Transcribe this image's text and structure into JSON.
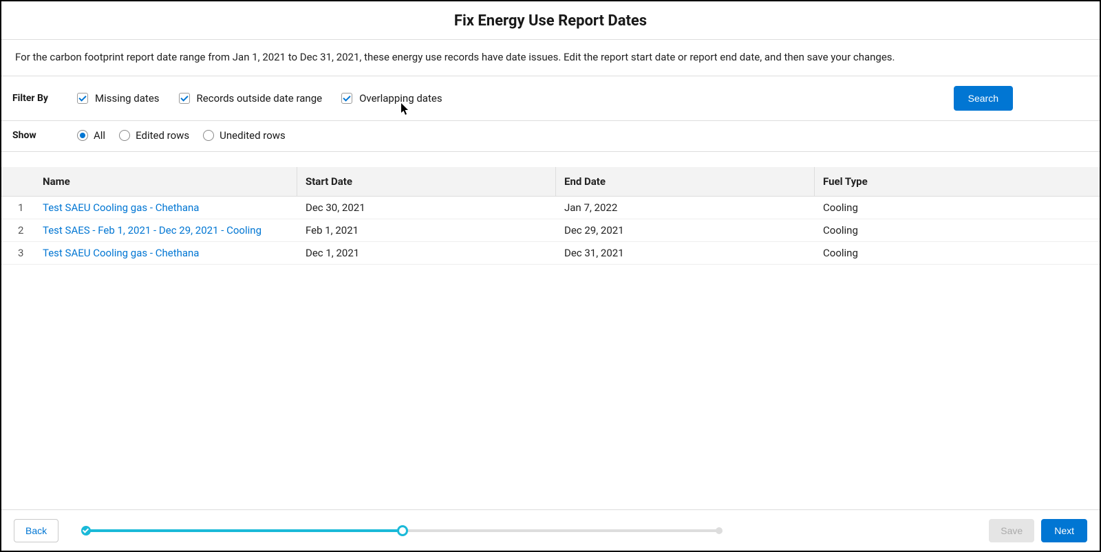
{
  "header": {
    "title": "Fix Energy Use Report Dates"
  },
  "description": "For the carbon footprint report date range from Jan 1, 2021 to Dec 31, 2021, these energy use records have date issues. Edit the report start date or report end date, and then save your changes.",
  "filters": {
    "label": "Filter By",
    "items": [
      {
        "label": "Missing dates",
        "checked": true
      },
      {
        "label": "Records outside date range",
        "checked": true
      },
      {
        "label": "Overlapping dates",
        "checked": true
      }
    ],
    "search": "Search"
  },
  "show": {
    "label": "Show",
    "options": [
      {
        "label": "All",
        "selected": true
      },
      {
        "label": "Edited rows",
        "selected": false
      },
      {
        "label": "Unedited rows",
        "selected": false
      }
    ]
  },
  "table": {
    "columns": {
      "name": "Name",
      "start": "Start Date",
      "end": "End Date",
      "fuel": "Fuel Type"
    },
    "rows": [
      {
        "num": "1",
        "name": "Test SAEU Cooling gas - Chethana",
        "start": "Dec 30, 2021",
        "end": "Jan 7, 2022",
        "fuel": "Cooling"
      },
      {
        "num": "2",
        "name": "Test SAES - Feb 1, 2021 - Dec 29, 2021 - Cooling",
        "start": "Feb 1, 2021",
        "end": "Dec 29, 2021",
        "fuel": "Cooling"
      },
      {
        "num": "3",
        "name": "Test SAEU Cooling gas - Chethana",
        "start": "Dec 1, 2021",
        "end": "Dec 31, 2021",
        "fuel": "Cooling"
      }
    ]
  },
  "footer": {
    "back": "Back",
    "save": "Save",
    "next": "Next"
  }
}
